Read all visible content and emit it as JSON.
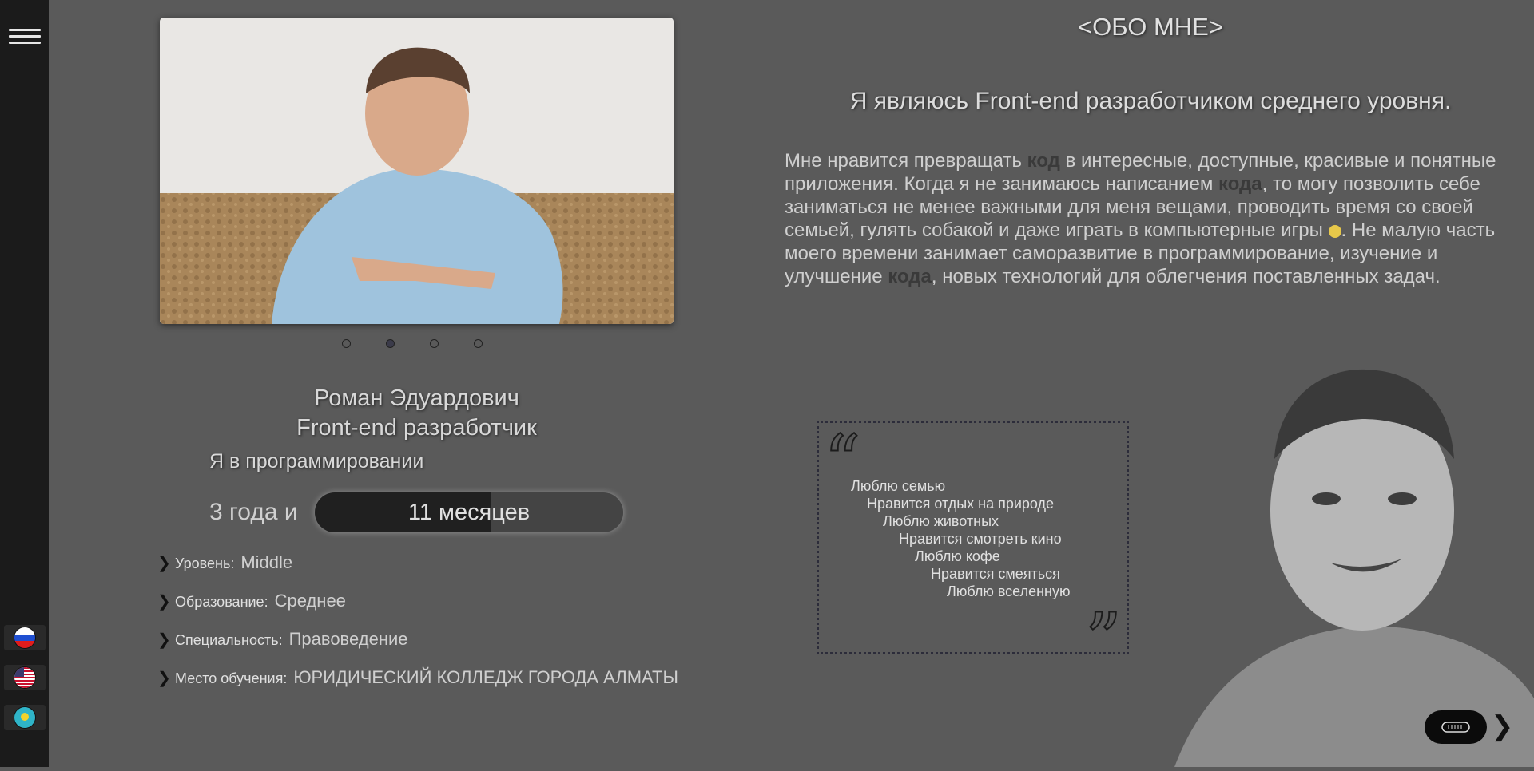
{
  "lang": [
    "ru",
    "us",
    "kz"
  ],
  "profile": {
    "name": "Роман Эдуардович",
    "role": "Front-end разработчик",
    "experience_label": "Я в программировании",
    "years": "3 года и",
    "months": "11 месяцев",
    "slider": {
      "count": 4,
      "active_index": 1
    }
  },
  "info": [
    {
      "label": "Уровень:",
      "value": "Middle"
    },
    {
      "label": "Образование:",
      "value": "Среднее"
    },
    {
      "label": "Специальность:",
      "value": "Правоведение"
    },
    {
      "label": "Место обучения:",
      "value": "ЮРИДИЧЕСКИЙ КОЛЛЕДЖ ГОРОДА АЛМАТЫ"
    }
  ],
  "about": {
    "title": "<ОБО МНЕ>",
    "subtitle": "Я являюсь Front-end разработчиком среднего уровня.",
    "p1": "Мне нравится превращать ",
    "kw1": "код",
    "p2": " в интересные, доступные, красивые и понятные приложения. Когда я не занимаюсь написанием ",
    "kw2": "кода",
    "p3": ", то могу позволить себе заниматься не менее важными для меня вещами, проводить время со своей семьей, гулять собакой и даже играть в компьютерные игры ",
    "p4": ". Не малую часть моего времени занимает саморазвитие в программирование, изучение и улучшение ",
    "kw3": "кода",
    "p5": ", новых технологий для облегчения поставленных задач."
  },
  "quotes": [
    "Люблю семью",
    "Нравится отдых на природе",
    "Люблю животных",
    "Нравится смотреть кино",
    "Люблю кофе",
    "Нравится смеяться",
    "Люблю вселенную"
  ],
  "icons": {
    "menu": "hamburger-icon",
    "next": "chevron-right-icon",
    "toggle": "theme-toggle-icon",
    "quote_open": "quote-open-icon",
    "quote_close": "quote-close-icon"
  }
}
